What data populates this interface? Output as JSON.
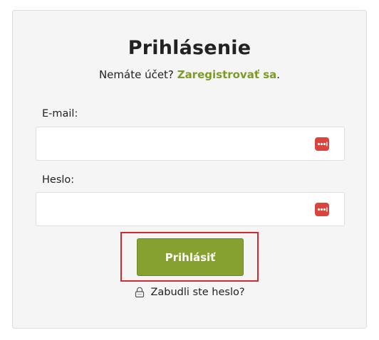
{
  "login": {
    "title": "Prihlásenie",
    "no_account_text": "Nemáte účet?",
    "register_link": "Zaregistrovať sa",
    "register_suffix": ".",
    "email_label": "E-mail:",
    "email_value": "",
    "password_label": "Heslo:",
    "password_value": "",
    "submit_label": "Prihlásiť",
    "forgot_label": "Zabudli ste heslo?"
  },
  "colors": {
    "accent": "#87a130",
    "link": "#7d9a28",
    "highlight": "#d42a2f",
    "password_manager_icon": "#d9453d",
    "card_background": "#f5f5f5"
  },
  "icons": {
    "email_field_icon": "password-manager-icon",
    "password_field_icon": "password-manager-icon",
    "forgot_icon": "lock-icon"
  }
}
